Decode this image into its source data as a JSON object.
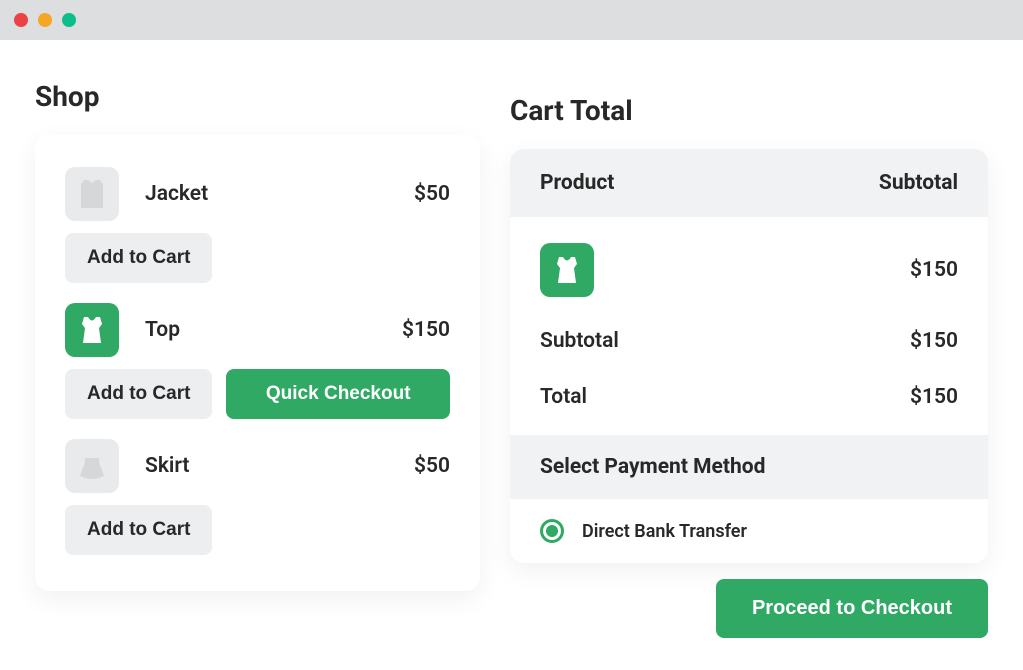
{
  "shop": {
    "title": "Shop",
    "products": [
      {
        "name": "Jacket",
        "price": "$50",
        "icon": "jacket",
        "active": false
      },
      {
        "name": "Top",
        "price": "$150",
        "icon": "top",
        "active": true
      },
      {
        "name": "Skirt",
        "price": "$50",
        "icon": "skirt",
        "active": false
      }
    ],
    "add_to_cart_label": "Add to Cart",
    "quick_checkout_label": "Quick Checkout"
  },
  "cart": {
    "title": "Cart Total",
    "header_product": "Product",
    "header_subtotal": "Subtotal",
    "item_price": "$150",
    "subtotal_label": "Subtotal",
    "subtotal_value": "$150",
    "total_label": "Total",
    "total_value": "$150",
    "payment_header": "Select Payment Method",
    "payment_option": "Direct Bank Transfer",
    "proceed_label": "Proceed to Checkout"
  }
}
